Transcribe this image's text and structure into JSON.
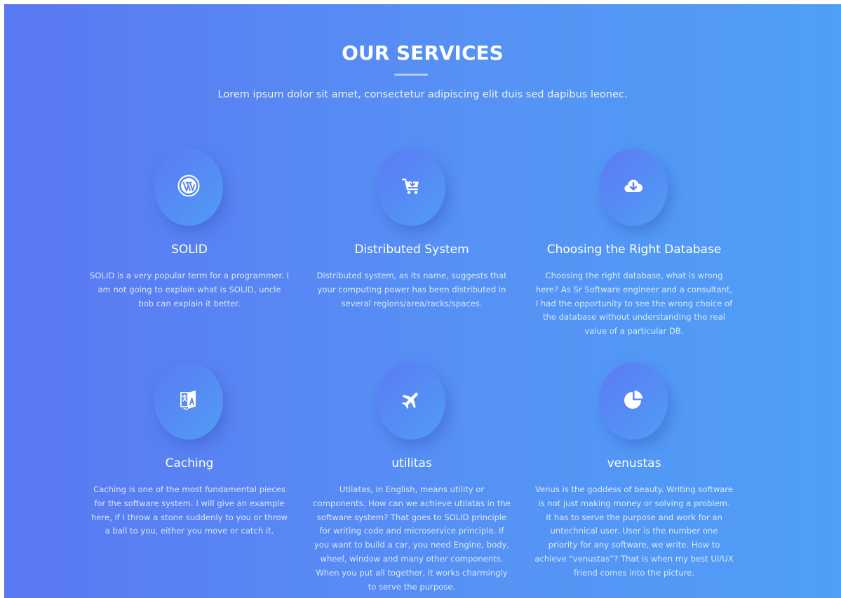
{
  "section": {
    "title": "OUR SERVICES",
    "subtitle": "Lorem ipsum dolor sit amet, consectetur adipiscing elit duis sed dapibus leonec."
  },
  "services": [
    {
      "icon": "wordpress-icon",
      "title": "SOLID",
      "text": "SOLID is a very popular term for a programmer. I am not going to explain what is SOLID, uncle bob can explain it better."
    },
    {
      "icon": "cart-download-icon",
      "title": "Distributed System",
      "text": "Distributed system, as its name, suggests that your computing power has been distributed in several regions/area/racks/spaces."
    },
    {
      "icon": "cloud-download-icon",
      "title": "Choosing the Right Database",
      "text": "Choosing the right database, what is wrong here? As Sr Software engineer and a consultant, I had the opportunity to see the wrong choice of the database without understanding the real value of a particular DB."
    },
    {
      "icon": "language-icon",
      "title": "Caching",
      "text": "Caching is one of the most fundamental pieces for the software system. I will give an example here, if I throw a stone suddenly to you or throw a ball to you, either you move or catch it."
    },
    {
      "icon": "plane-icon",
      "title": "utilitas",
      "text": "Utilatas, in English, means utility or components. How can we achieve utilatas in the software system? That goes to SOLID principle for writing code and microservice principle. If you want to build a car, you need Engine, body, wheel, window and many other components. When you put all together, it works charmingly to serve the purpose."
    },
    {
      "icon": "pie-chart-icon",
      "title": "venustas",
      "text": "Venus is the goddess of beauty. Writing software is not just making money or solving a problem. It has to serve the purpose and work for an untechnical user. User is the number one priority for any software, we write. How to achieve “venustas”? That is when my best UI/UX friend comes into the picture."
    }
  ]
}
